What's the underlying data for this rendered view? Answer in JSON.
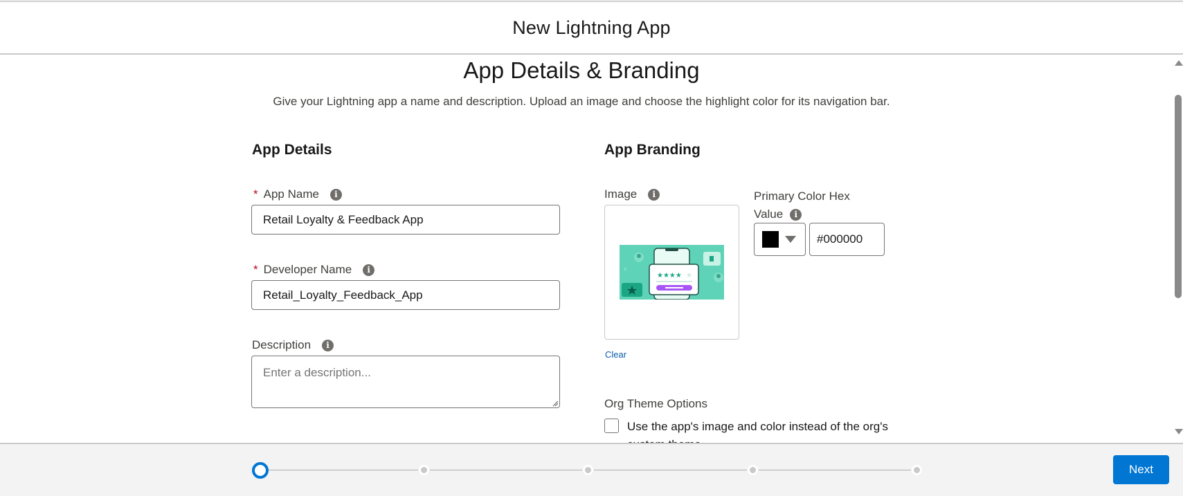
{
  "modal": {
    "title": "New Lightning App"
  },
  "section": {
    "title": "App Details & Branding",
    "description": "Give your Lightning app a name and description. Upload an image and choose the highlight color for its navigation bar."
  },
  "app_details": {
    "heading": "App Details",
    "app_name": {
      "required_marker": "*",
      "label": "App Name",
      "value": "Retail Loyalty & Feedback App"
    },
    "developer_name": {
      "required_marker": "*",
      "label": "Developer Name",
      "value": "Retail_Loyalty_Feedback_App"
    },
    "description": {
      "label": "Description",
      "placeholder": "Enter a description..."
    }
  },
  "app_branding": {
    "heading": "App Branding",
    "image": {
      "label": "Image",
      "clear_label": "Clear"
    },
    "primary_color": {
      "label_line1": "Primary Color Hex",
      "label_line2": "Value",
      "swatch_color": "#000000",
      "hex_value": "#000000"
    },
    "org_theme": {
      "heading": "Org Theme Options",
      "checkbox_label": "Use the app's image and color instead of the org's custom theme",
      "checked": false
    }
  },
  "footer": {
    "steps": [
      {
        "state": "current"
      },
      {
        "state": "pending"
      },
      {
        "state": "pending"
      },
      {
        "state": "pending"
      },
      {
        "state": "pending"
      }
    ],
    "next_label": "Next"
  },
  "colors": {
    "brand": "#0176d3",
    "link": "#0b5cab",
    "required": "#ba0517",
    "image_teal": "#5ed3b8",
    "image_purple": "#a855f7"
  }
}
